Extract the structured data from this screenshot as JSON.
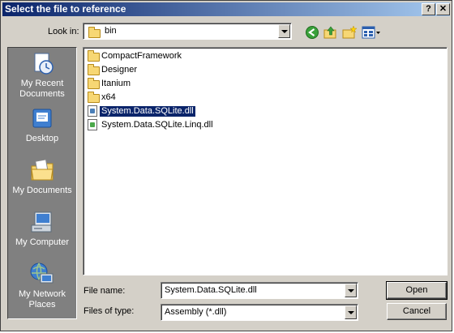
{
  "window": {
    "title": "Select the file to reference"
  },
  "titlebar_buttons": {
    "help": "?",
    "close": "✕"
  },
  "lookin": {
    "label": "Look in:",
    "value": "bin"
  },
  "toolbar": {
    "back": "back-icon",
    "up": "up-folder-icon",
    "new_folder": "new-folder-icon",
    "view_menu": "view-menu-icon"
  },
  "places": [
    {
      "label": "My Recent Documents",
      "icon": "recent-documents-icon"
    },
    {
      "label": "Desktop",
      "icon": "desktop-icon"
    },
    {
      "label": "My Documents",
      "icon": "my-documents-icon"
    },
    {
      "label": "My Computer",
      "icon": "my-computer-icon"
    },
    {
      "label": "My Network Places",
      "icon": "network-places-icon"
    }
  ],
  "files": [
    {
      "name": "CompactFramework",
      "type": "folder"
    },
    {
      "name": "Designer",
      "type": "folder"
    },
    {
      "name": "Itanium",
      "type": "folder"
    },
    {
      "name": "x64",
      "type": "folder"
    },
    {
      "name": "System.Data.SQLite.dll",
      "type": "dll",
      "selected": true
    },
    {
      "name": "System.Data.SQLite.Linq.dll",
      "type": "dll"
    }
  ],
  "filename": {
    "label": "File name:",
    "value": "System.Data.SQLite.dll"
  },
  "filetype": {
    "label": "Files of type:",
    "value": "Assembly (*.dll)"
  },
  "buttons": {
    "open": "Open",
    "cancel": "Cancel"
  },
  "colors": {
    "title_start": "#0a246a",
    "title_end": "#a6caf0",
    "face": "#d4d0c8",
    "places_bg": "#808080",
    "selection": "#0a246a"
  }
}
